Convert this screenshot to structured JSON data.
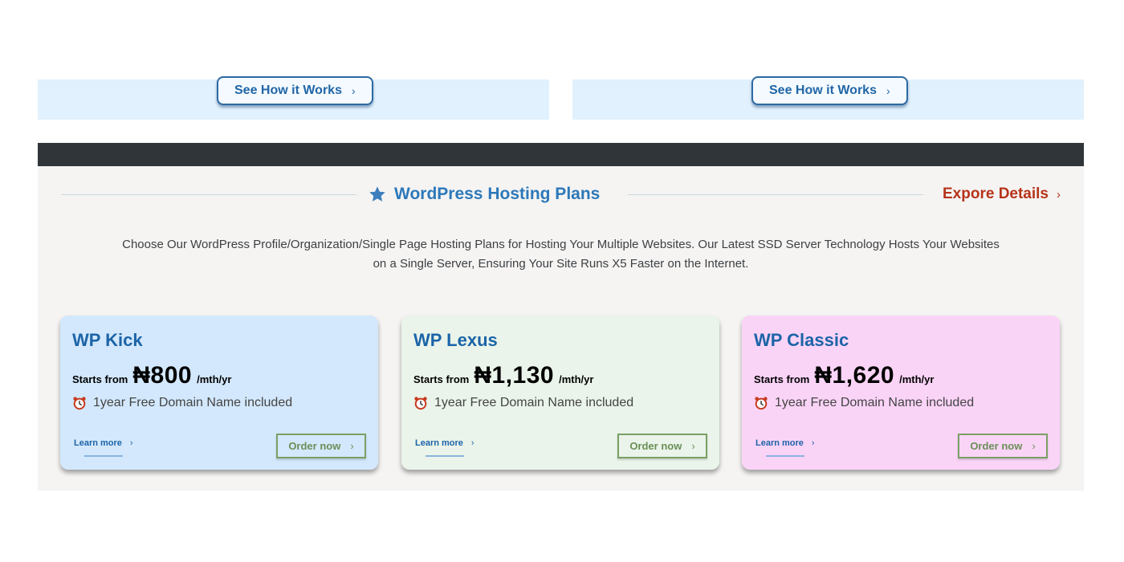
{
  "top_panels": {
    "left_button": "See How it Works",
    "right_button": "See How it Works",
    "chevron": "›"
  },
  "section": {
    "title": "WordPress Hosting Plans",
    "title_icon": "star-icon",
    "explore_label": "Expore Details",
    "chevron": "›",
    "description": "Choose Our WordPress Profile/Organization/Single Page Hosting Plans for Hosting Your Multiple Websites. Our Latest SSD Server Technology Hosts Your Websites on a Single Server, Ensuring Your Site Runs X5 Faster on the Internet."
  },
  "plans": [
    {
      "name": "WP Kick",
      "starts_from": "Starts from",
      "price": "₦800",
      "period": "/mth/yr",
      "domain": "1year Free Domain Name included",
      "learn_more": "Learn more",
      "order": "Order now",
      "bg": "#d3e8fc"
    },
    {
      "name": "WP Lexus",
      "starts_from": "Starts from",
      "price": "₦1,130",
      "period": "/mth/yr",
      "domain": "1year Free Domain Name included",
      "learn_more": "Learn more",
      "order": "Order now",
      "bg": "#eaf4ea"
    },
    {
      "name": "WP Classic",
      "starts_from": "Starts from",
      "price": "₦1,620",
      "period": "/mth/yr",
      "domain": "1year Free Domain Name included",
      "learn_more": "Learn more",
      "order": "Order now",
      "bg": "#fad4f7"
    }
  ],
  "colors": {
    "accent_blue": "#2d78b9",
    "explore_red": "#b63319",
    "order_green": "#7a9f64",
    "dark_bar": "#30353a"
  }
}
